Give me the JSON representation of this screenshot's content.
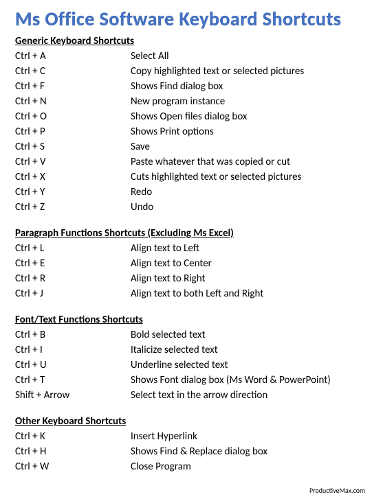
{
  "title": "Ms Office Software Keyboard Shortcuts",
  "footer": "ProductiveMax.com",
  "sections": [
    {
      "heading": "Generic Keyboard Shortcuts",
      "rows": [
        {
          "key": "Ctrl + A",
          "desc": "Select All"
        },
        {
          "key": "Ctrl + C",
          "desc": "Copy highlighted text or selected pictures"
        },
        {
          "key": "Ctrl + F",
          "desc": "Shows Find dialog box"
        },
        {
          "key": "Ctrl + N",
          "desc": "New program instance"
        },
        {
          "key": "Ctrl + O",
          "desc": "Shows Open files dialog box"
        },
        {
          "key": "Ctrl + P",
          "desc": "Shows Print options"
        },
        {
          "key": "Ctrl + S",
          "desc": "Save"
        },
        {
          "key": "Ctrl + V",
          "desc": "Paste whatever that was copied or cut"
        },
        {
          "key": "Ctrl + X",
          "desc": "Cuts highlighted text or selected pictures"
        },
        {
          "key": "Ctrl + Y",
          "desc": "Redo"
        },
        {
          "key": "Ctrl + Z",
          "desc": "Undo"
        }
      ]
    },
    {
      "heading": "Paragraph Functions Shortcuts (Excluding Ms Excel)",
      "rows": [
        {
          "key": "Ctrl + L",
          "desc": "Align text to Left"
        },
        {
          "key": "Ctrl + E",
          "desc": "Align text to Center"
        },
        {
          "key": "Ctrl + R",
          "desc": "Align text to Right"
        },
        {
          "key": "Ctrl + J",
          "desc": "Align text to both Left and Right"
        }
      ]
    },
    {
      "heading": "Font/Text Functions Shortcuts",
      "rows": [
        {
          "key": "Ctrl + B",
          "desc": "Bold selected text"
        },
        {
          "key": "Ctrl + I",
          "desc": "Italicize selected text"
        },
        {
          "key": "Ctrl + U",
          "desc": "Underline selected text"
        },
        {
          "key": "Ctrl + T",
          "desc": "Shows Font dialog box (Ms Word & PowerPoint)"
        },
        {
          "key": "Shift + Arrow",
          "desc": "Select text in the arrow direction"
        }
      ]
    },
    {
      "heading": "Other Keyboard Shortcuts",
      "rows": [
        {
          "key": "Ctrl + K",
          "desc": "Insert Hyperlink"
        },
        {
          "key": "Ctrl + H",
          "desc": "Shows Find & Replace dialog box"
        },
        {
          "key": "Ctrl + W",
          "desc": "Close Program"
        }
      ]
    }
  ]
}
